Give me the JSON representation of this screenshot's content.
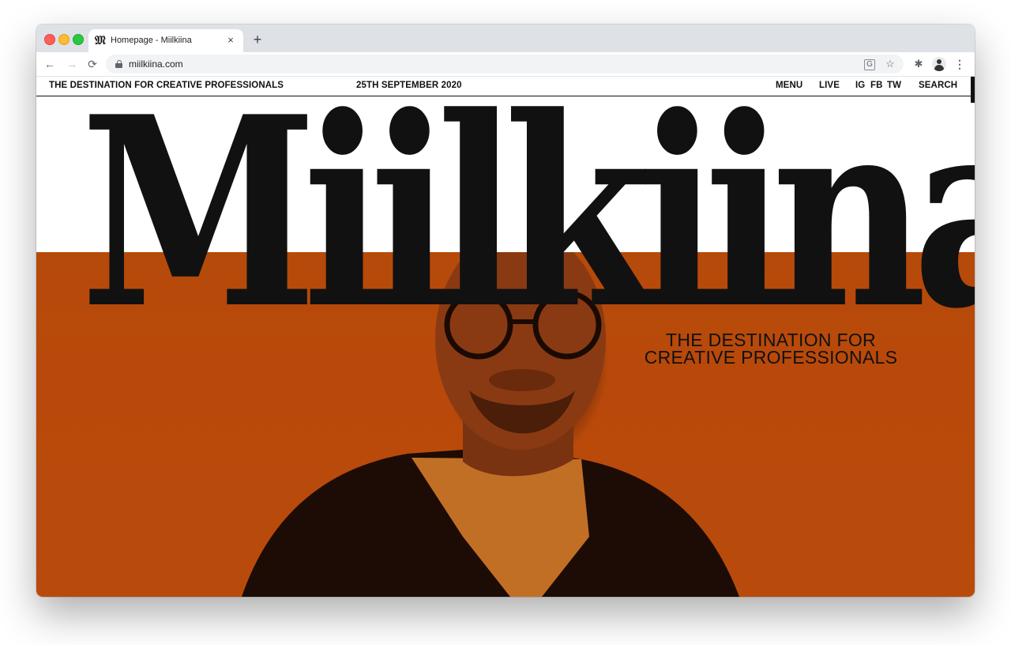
{
  "browser": {
    "tab": {
      "favicon": "𝔐",
      "title": "Homepage - Miilkiina"
    },
    "new_tab_label": "+",
    "url": "miilkiina.com",
    "icons": {
      "back": "←",
      "forward": "→",
      "reload": "⟳",
      "translate": "G",
      "star": "☆",
      "extensions": "✱",
      "menu": "⋮",
      "close": "×"
    }
  },
  "site": {
    "nav": {
      "tagline": "THE DESTINATION FOR CREATIVE PROFESSIONALS",
      "date": "25TH SEPTEMBER 2020",
      "menu": "MENU",
      "live": "LIVE",
      "ig": "IG",
      "fb": "FB",
      "tw": "TW",
      "search": "SEARCH"
    },
    "hero": {
      "wordmark": "Miilkiina",
      "tagline_line1": "THE DESTINATION FOR",
      "tagline_line2": "CREATIVE PROFESSIONALS",
      "background_color": "#b84b0c"
    }
  }
}
